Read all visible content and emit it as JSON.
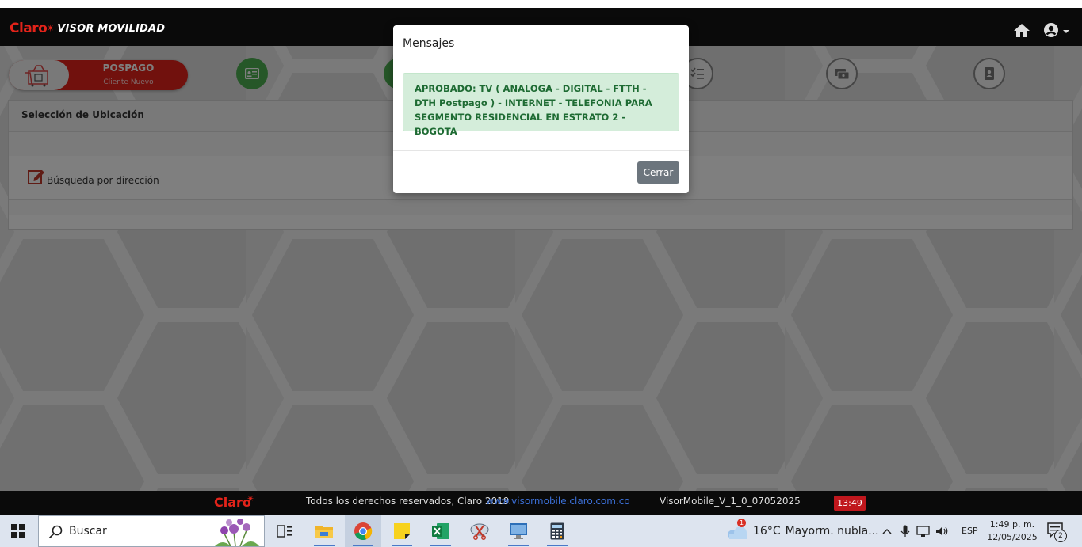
{
  "header": {
    "brand_claro": "Claro",
    "brand_app": "VISOR MOVILIDAD"
  },
  "plan": {
    "title": "POSPAGO",
    "subtitle": "Cliente Nuevo"
  },
  "panel": {
    "title": "Selección de Ubicación",
    "address_search_label": "Búsqueda por dirección"
  },
  "modal": {
    "title": "Mensajes",
    "message": "APROBADO: TV ( ANALOGA - DIGITAL - FTTH - DTH Postpago ) - INTERNET - TELEFONIA PARA SEGMENTO RESIDENCIAL EN ESTRATO 2 -BOGOTA",
    "close_label": "Cerrar"
  },
  "footer": {
    "brand": "Claro",
    "rights": "Todos los derechos reservados, Claro 2019",
    "url": "www.visormobile.claro.com.co",
    "version": "VisorMobile_V_1_0_07052025",
    "session_time": "13:49"
  },
  "taskbar": {
    "search_placeholder": "Buscar",
    "weather_temp": "16°C",
    "weather_desc": "Mayorm. nubla...",
    "weather_badge": "1",
    "language": "ESP",
    "time": "1:49 p. m.",
    "date": "12/05/2025",
    "notifications": "2"
  },
  "colors": {
    "brand_red": "#e2231a",
    "success_bg": "#d4edda",
    "success_text": "#1e6b33",
    "step_green": "#4caf50"
  }
}
